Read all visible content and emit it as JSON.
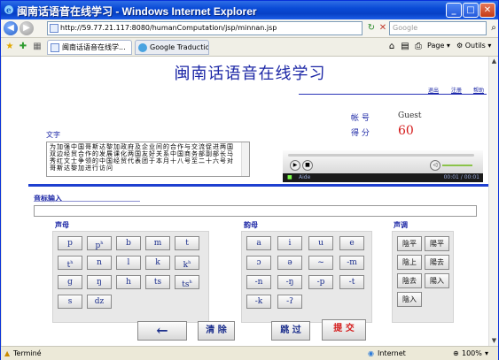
{
  "window": {
    "title": "闽南话语音在线学习 - Windows Internet Explorer",
    "url": "http://59.77.21.117:8080/humanComputation/jsp/minnan.jsp",
    "search_placeholder": "Google",
    "tabs": [
      "闽南话语音在线学...",
      "Google Traduction"
    ],
    "toolbar": [
      "Page",
      "Outils"
    ],
    "status_left": "Terminé",
    "status_zone": "Internet",
    "zoom": "100%"
  },
  "page": {
    "title": "闽南话语音在线学习",
    "links": [
      "退出",
      "注册",
      "帮助"
    ],
    "account_label": "帐 号",
    "account_value": "Guest",
    "score_label": "得 分",
    "score_value": "60",
    "text_section_label": "文字",
    "passage": "为加强中国哥斯达黎加政府及企业间的合作与交流促进两国双边经贸合作的发展课化两国友好关系中国商务部副部长马秀红文士争领的中国经贸代表团于本月十八号至二十六号对哥斯达黎加进行访问",
    "player": {
      "track": "Aide",
      "time": "00:01 / 00:01"
    },
    "input_label": "音标输入",
    "consonant_label": "声母",
    "consonants": [
      [
        "p",
        "pʰ",
        "b",
        "m",
        "t"
      ],
      [
        "tʰ",
        "n",
        "l",
        "k",
        "kʰ"
      ],
      [
        "g",
        "ŋ",
        "h",
        "ts",
        "tsʰ"
      ],
      [
        "s",
        "dz"
      ]
    ],
    "vowel_label": "韵母",
    "vowels": [
      [
        "a",
        "i",
        "u",
        "e"
      ],
      [
        "ɔ",
        "ə",
        "~",
        "-m"
      ],
      [
        "-n",
        "-ŋ",
        "-p",
        "-t"
      ],
      [
        "-k",
        "-ʔ"
      ]
    ],
    "tone_label": "声调",
    "tones": [
      [
        "陰平",
        "陽平"
      ],
      [
        "陰上",
        "陽去"
      ],
      [
        "陰去",
        "陽入"
      ],
      [
        "陰入"
      ]
    ],
    "actions": {
      "back_glyph": "←",
      "clear": "清 除",
      "skip": "跳 过",
      "submit": "提 交"
    }
  },
  "colors": {
    "heading_blue": "#1c27a6",
    "score_red": "#d41a1a",
    "divider_blue": "#1e3fd0"
  }
}
